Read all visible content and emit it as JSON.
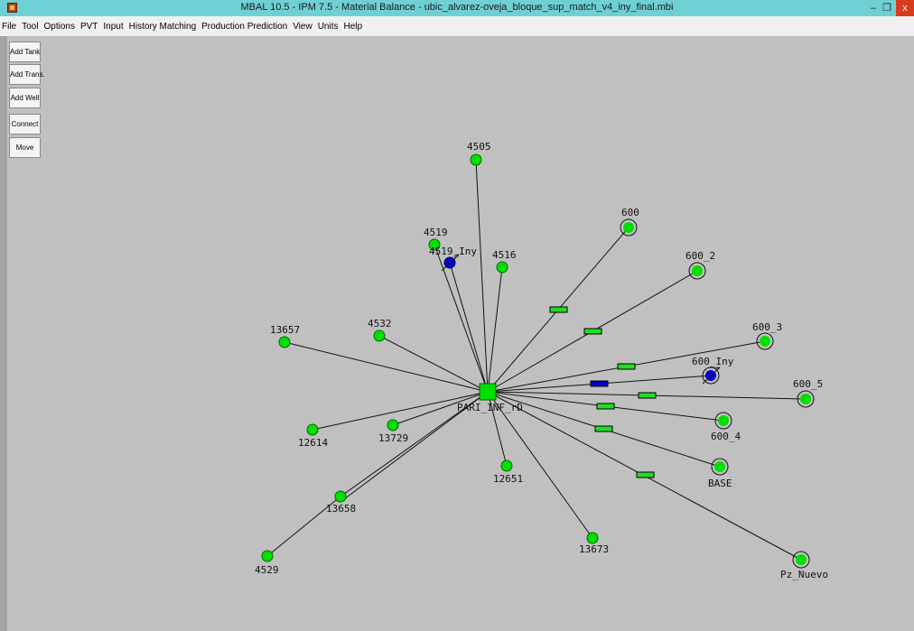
{
  "window": {
    "title": "MBAL 10.5 - IPM 7.5 - Material Balance - ubic_alvarez-oveja_bloque_sup_match_v4_iny_final.mbi",
    "minimize_glyph": "–",
    "maximize_glyph": "❐",
    "close_glyph": "x"
  },
  "menu": [
    "File",
    "Tool",
    "Options",
    "PVT",
    "Input",
    "History Matching",
    "Production Prediction",
    "View",
    "Units",
    "Help"
  ],
  "toolbar": {
    "add_tank": "Add Tank",
    "add_trans": "Add Trans.",
    "add_well": "Add Well",
    "connect": "Connect",
    "move": "Move"
  },
  "colors": {
    "well_green": "#00e000",
    "injector_blue": "#0000dd",
    "transfer_green": "#22dd22",
    "transfer_blue": "#0000cc"
  },
  "tank": {
    "label": "PARI_INF_rD"
  },
  "wells": {
    "w4505": "4505",
    "w4519": "4519",
    "w4519_iny": "4519_Iny",
    "w4516": "4516",
    "w600": "600",
    "w600_2": "600_2",
    "w600_3": "600_3",
    "w600_iny": "600_Iny",
    "w600_5": "600_5",
    "w600_4": "600_4",
    "base": "BASE",
    "pz_nuevo": "Pz_Nuevo",
    "w13673": "13673",
    "w12651": "12651",
    "w13729": "13729",
    "w12614": "12614",
    "w13658": "13658",
    "w4529": "4529",
    "w13657": "13657",
    "w4532": "4532"
  }
}
